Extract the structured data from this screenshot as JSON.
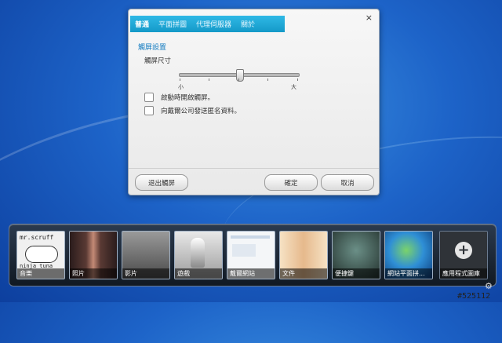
{
  "dialog": {
    "tabs": [
      {
        "label": "普通",
        "active": true
      },
      {
        "label": "平面拼圖",
        "active": false
      },
      {
        "label": "代理伺服器",
        "active": false
      },
      {
        "label": "關於",
        "active": false
      }
    ],
    "close_label": "×",
    "section_title": "觸屏設置",
    "slider": {
      "label": "觸屏尺寸",
      "min_label": "小",
      "max_label": "大",
      "value_fraction": 0.5
    },
    "checkboxes": [
      {
        "label": "啟動時開啟觸屏。",
        "checked": false
      },
      {
        "label": "向戴爾公司發送匿名資料。",
        "checked": false
      }
    ],
    "buttons": {
      "exit_touch": "退出觸屏",
      "ok": "確定",
      "cancel": "取消"
    }
  },
  "taskbar": {
    "tiles": [
      {
        "label": "音樂",
        "thumb_text_top": "mr.scruff",
        "thumb_text_bottom": "ninja tuna",
        "bg": "#f0f0f0"
      },
      {
        "label": "照片",
        "bg": "#3a2a2a"
      },
      {
        "label": "影片",
        "bg": "#6f6f6f"
      },
      {
        "label": "遊戲",
        "bg": "#d8d8d8"
      },
      {
        "label": "戴爾網站",
        "bg": "#f4f6f8"
      },
      {
        "label": "文件",
        "bg": "#f2d7b8"
      },
      {
        "label": "便捷鍵",
        "bg": "#3b4f4b"
      },
      {
        "label": "網站平面拼...",
        "bg": "#2a6fb2"
      },
      {
        "label": "應用程式圖庫",
        "icon": "plus-icon",
        "bg": "#2f3338"
      }
    ],
    "settings_icon": "gear-icon"
  },
  "watermark": "#525112"
}
